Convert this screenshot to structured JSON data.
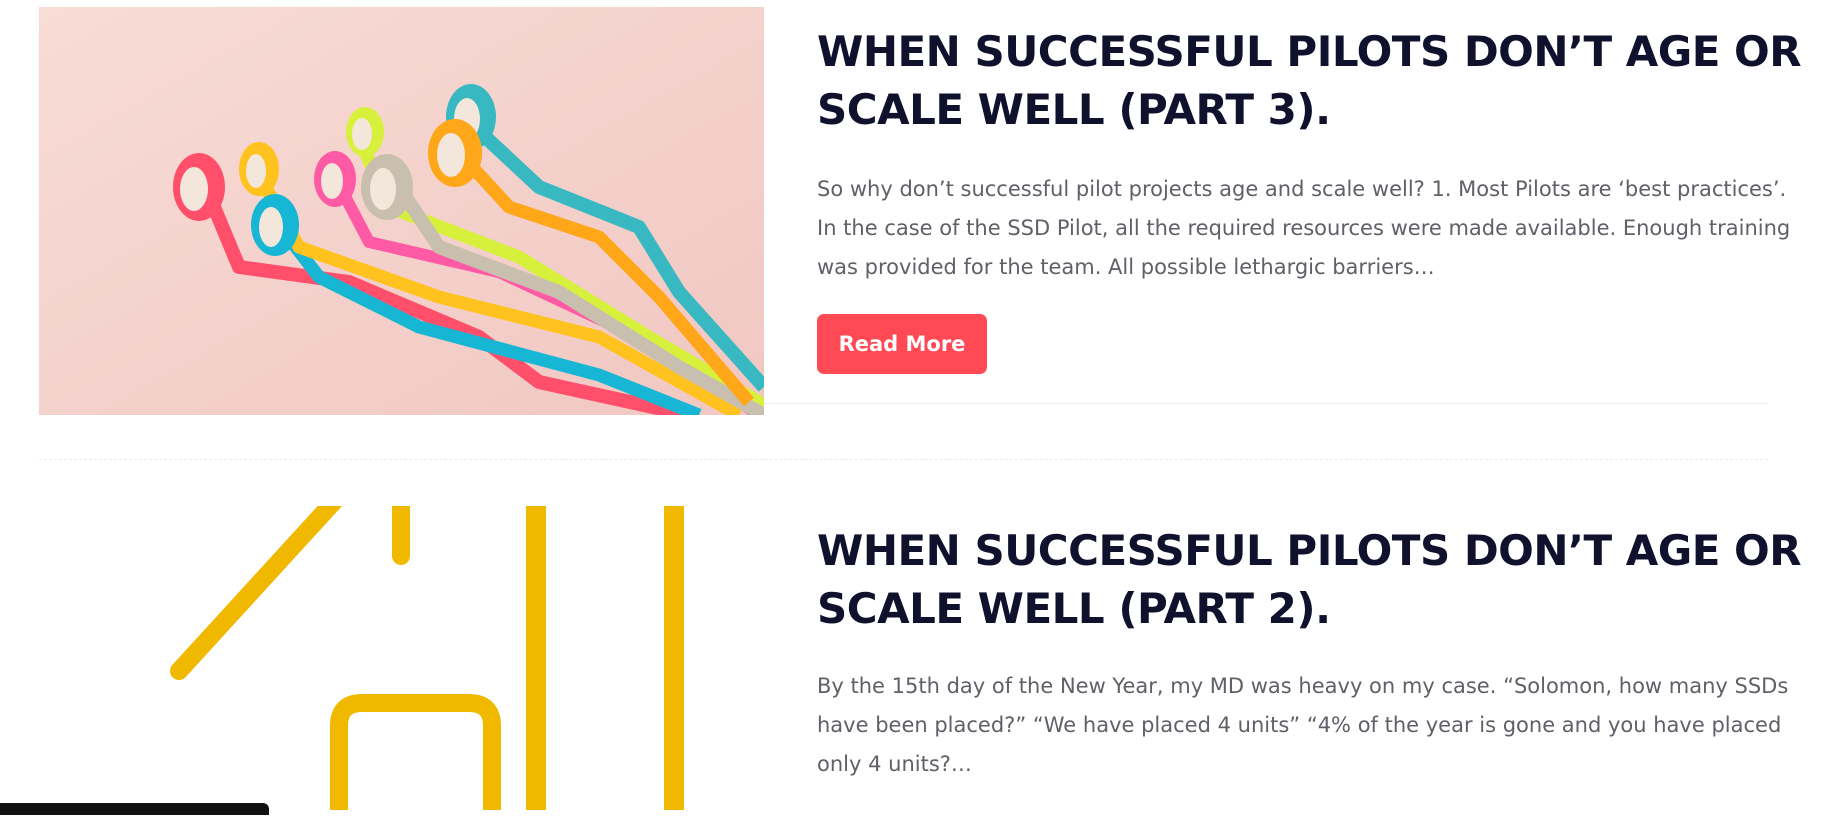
{
  "posts": [
    {
      "title": "WHEN SUCCESSFUL PILOTS DON’T AGE OR SCALE WELL (PART 3).",
      "excerpt": "So why don’t successful pilot projects age and scale well? 1.       Most Pilots are ‘best practices’. In the case of the SSD Pilot, all the required resources were made available. Enough training was provided for the team. All possible lethargic barriers…",
      "read_more_label": "Read More",
      "thumbnail_icon": "washi-tape-rolls-image"
    },
    {
      "title": "WHEN SUCCESSFUL PILOTS DON’T AGE OR SCALE WELL (PART 2).",
      "excerpt": "By the 15th day of the New Year, my MD was heavy on my case. “Solomon, how many SSDs have been placed?” “We have placed 4 units” “4% of the year is gone and you have placed only 4 units?…",
      "thumbnail_icon": "yellow-line-house-image"
    }
  ],
  "colors": {
    "title": "#10112d",
    "excerpt": "#5f6068",
    "button": "#ff4a56",
    "thumb_bg_pink": "#f6d5cf",
    "house_yellow": "#f1b800"
  }
}
